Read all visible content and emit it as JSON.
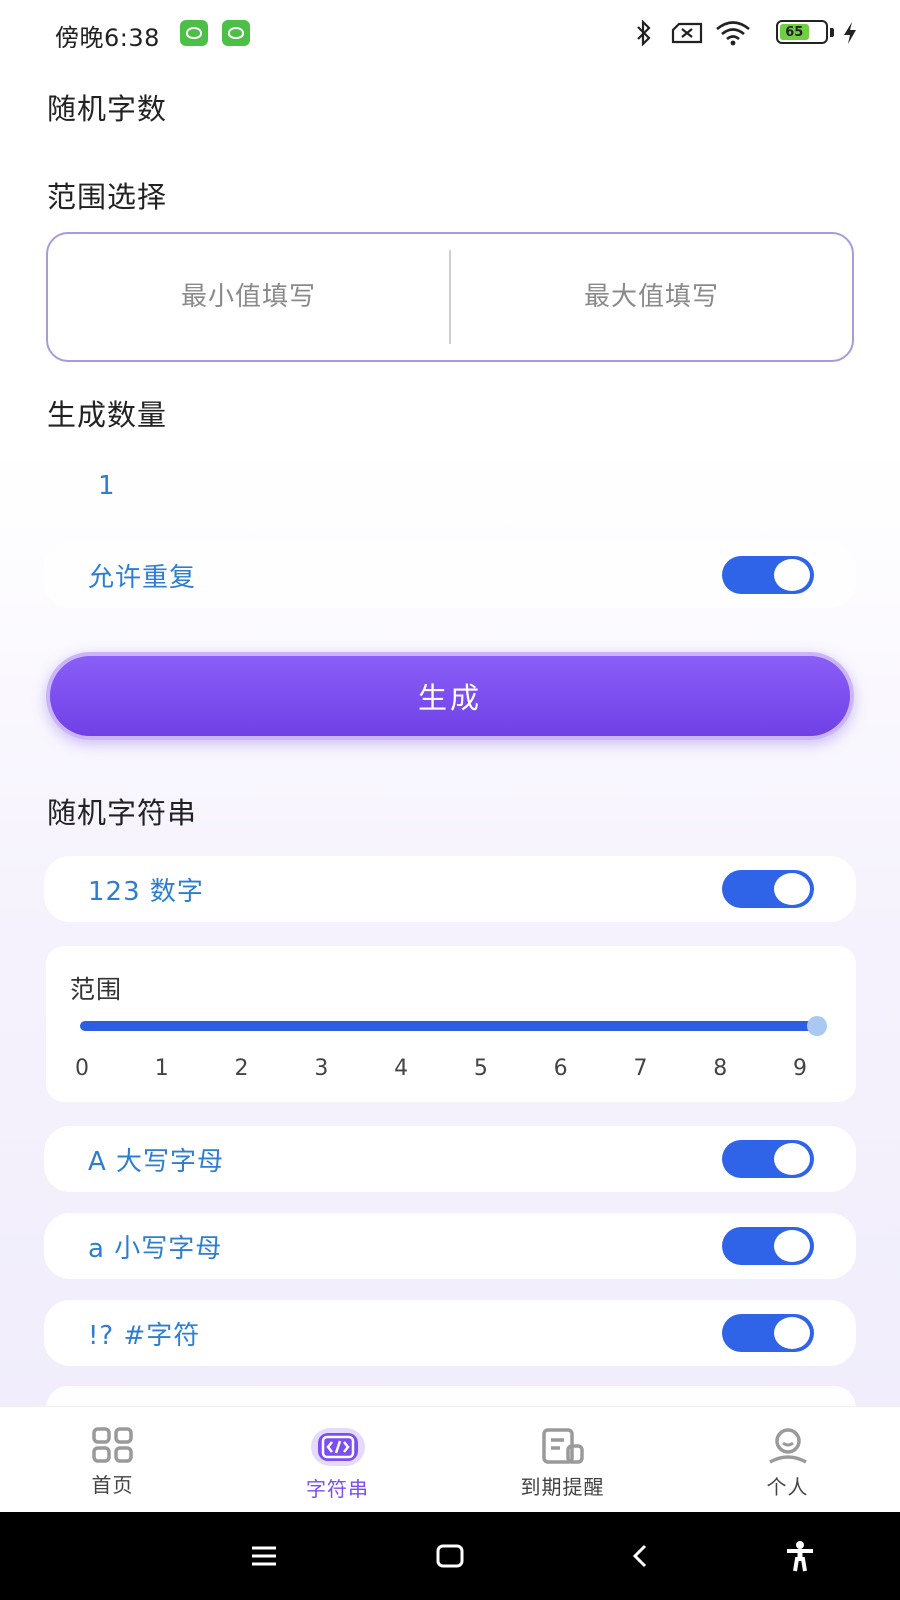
{
  "status_bar": {
    "time": "傍晚6:38",
    "battery_level": "65",
    "icons": [
      "app-badge-icon",
      "bluetooth-icon",
      "sim-card-icon",
      "wifi-icon",
      "battery-icon",
      "charging-icon"
    ]
  },
  "random_number": {
    "title": "随机字数",
    "range_label": "范围选择",
    "min_placeholder": "最小值填写",
    "max_placeholder": "最大值填写",
    "count_label": "生成数量",
    "count_value": "1",
    "allow_repeat_label": "允许重复",
    "allow_repeat_on": true,
    "generate_label": "生成"
  },
  "random_string": {
    "title": "随机字符串",
    "digits_label": "123 数字",
    "digits_on": true,
    "range_label": "范围",
    "range_ticks": [
      "0",
      "1",
      "2",
      "3",
      "4",
      "5",
      "6",
      "7",
      "8",
      "9"
    ],
    "range_min": 0,
    "range_max": 9,
    "uppercase_label": "A 大写字母",
    "uppercase_on": true,
    "lowercase_label": "a 小写字母",
    "lowercase_on": true,
    "symbols_label": "!? #字符",
    "symbols_on": true
  },
  "bottom_nav": {
    "items": [
      {
        "label": "首页",
        "icon": "grid-icon"
      },
      {
        "label": "字符串",
        "icon": "code-icon"
      },
      {
        "label": "到期提醒",
        "icon": "calendar-note-icon"
      },
      {
        "label": "个人",
        "icon": "person-icon"
      }
    ],
    "active_index": 1
  },
  "colors": {
    "accent": "#7a4ef0",
    "switch_on": "#2f64e8",
    "link_text": "#2c7fd0",
    "range_border": "#a99ad8"
  }
}
